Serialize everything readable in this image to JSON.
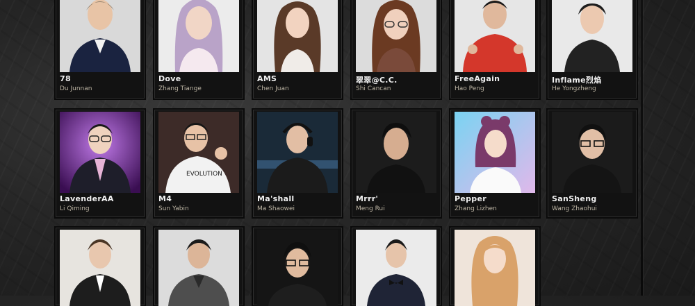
{
  "casters": [
    {
      "handle": "78",
      "name": "Du Junnan"
    },
    {
      "handle": "Dove",
      "name": "Zhang Tiange"
    },
    {
      "handle": "AMS",
      "name": "Chen Juan"
    },
    {
      "handle": "翠翠@C.C.",
      "name": "Shi Cancan"
    },
    {
      "handle": "FreeAgain",
      "name": "Hao Peng"
    },
    {
      "handle": "Inflame烈焰",
      "name": "He Yongzheng"
    },
    {
      "handle": "LavenderAA",
      "name": "Li Qiming"
    },
    {
      "handle": "M4",
      "name": "Sun Yabin"
    },
    {
      "handle": "Ma'shall",
      "name": "Ma Shaowei"
    },
    {
      "handle": "Mrrr'",
      "name": "Meng Rui"
    },
    {
      "handle": "Pepper",
      "name": "Zhang Lizhen"
    },
    {
      "handle": "SanSheng",
      "name": "Wang Zhaohui"
    },
    {
      "handle": "",
      "name": ""
    },
    {
      "handle": "",
      "name": ""
    },
    {
      "handle": "",
      "name": ""
    },
    {
      "handle": "",
      "name": ""
    },
    {
      "handle": "",
      "name": ""
    }
  ],
  "photo_icon": "person-portrait-icon"
}
